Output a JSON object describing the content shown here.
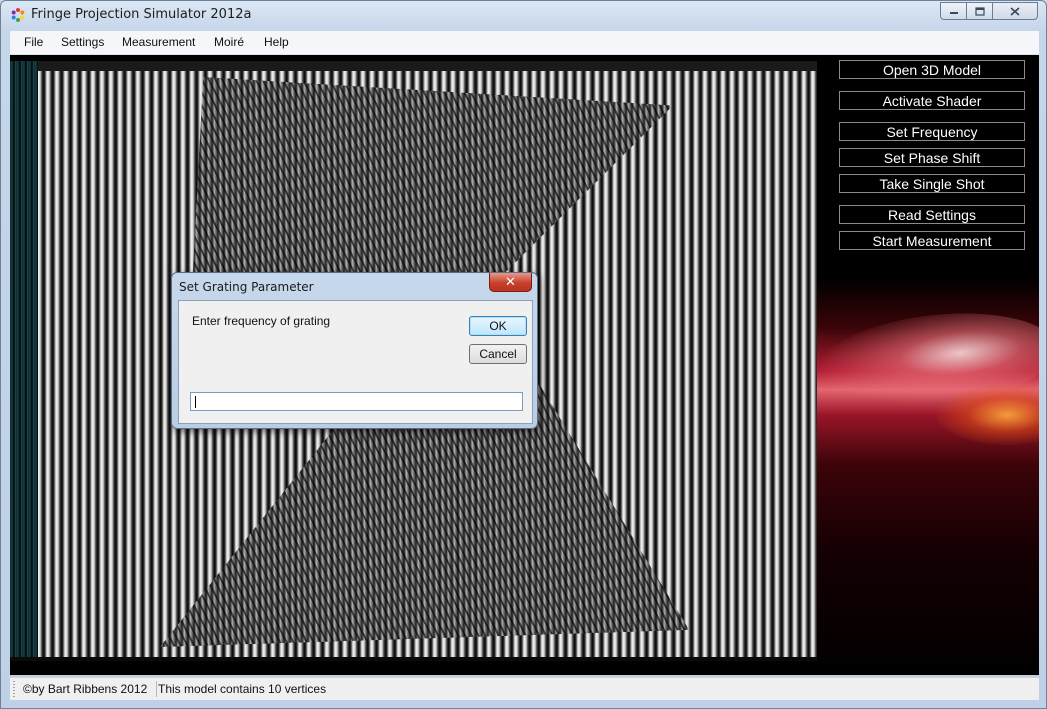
{
  "window": {
    "title": "Fringe Projection Simulator 2012a"
  },
  "menu": {
    "items": [
      "File",
      "Settings",
      "Measurement",
      "Moiré",
      "Help"
    ]
  },
  "panel": {
    "buttons": [
      "Open 3D Model",
      "Activate Shader",
      "Set Frequency",
      "Set Phase Shift",
      "Take Single Shot",
      "Read Settings",
      "Start Measurement"
    ]
  },
  "dialog": {
    "title": "Set Grating Parameter",
    "prompt": "Enter frequency of grating",
    "ok_label": "OK",
    "cancel_label": "Cancel",
    "close_label": "✕",
    "input_value": ""
  },
  "status": {
    "copyright": "©by Bart Ribbens 2012",
    "info": "This model contains 10 vertices"
  },
  "icons": {
    "app": "app-icon",
    "minimize": "minimize-icon",
    "maximize": "maximize-icon",
    "close": "close-icon"
  },
  "colors": {
    "dialog_close": "#c8402c",
    "panel_accent": "#b51f35"
  }
}
